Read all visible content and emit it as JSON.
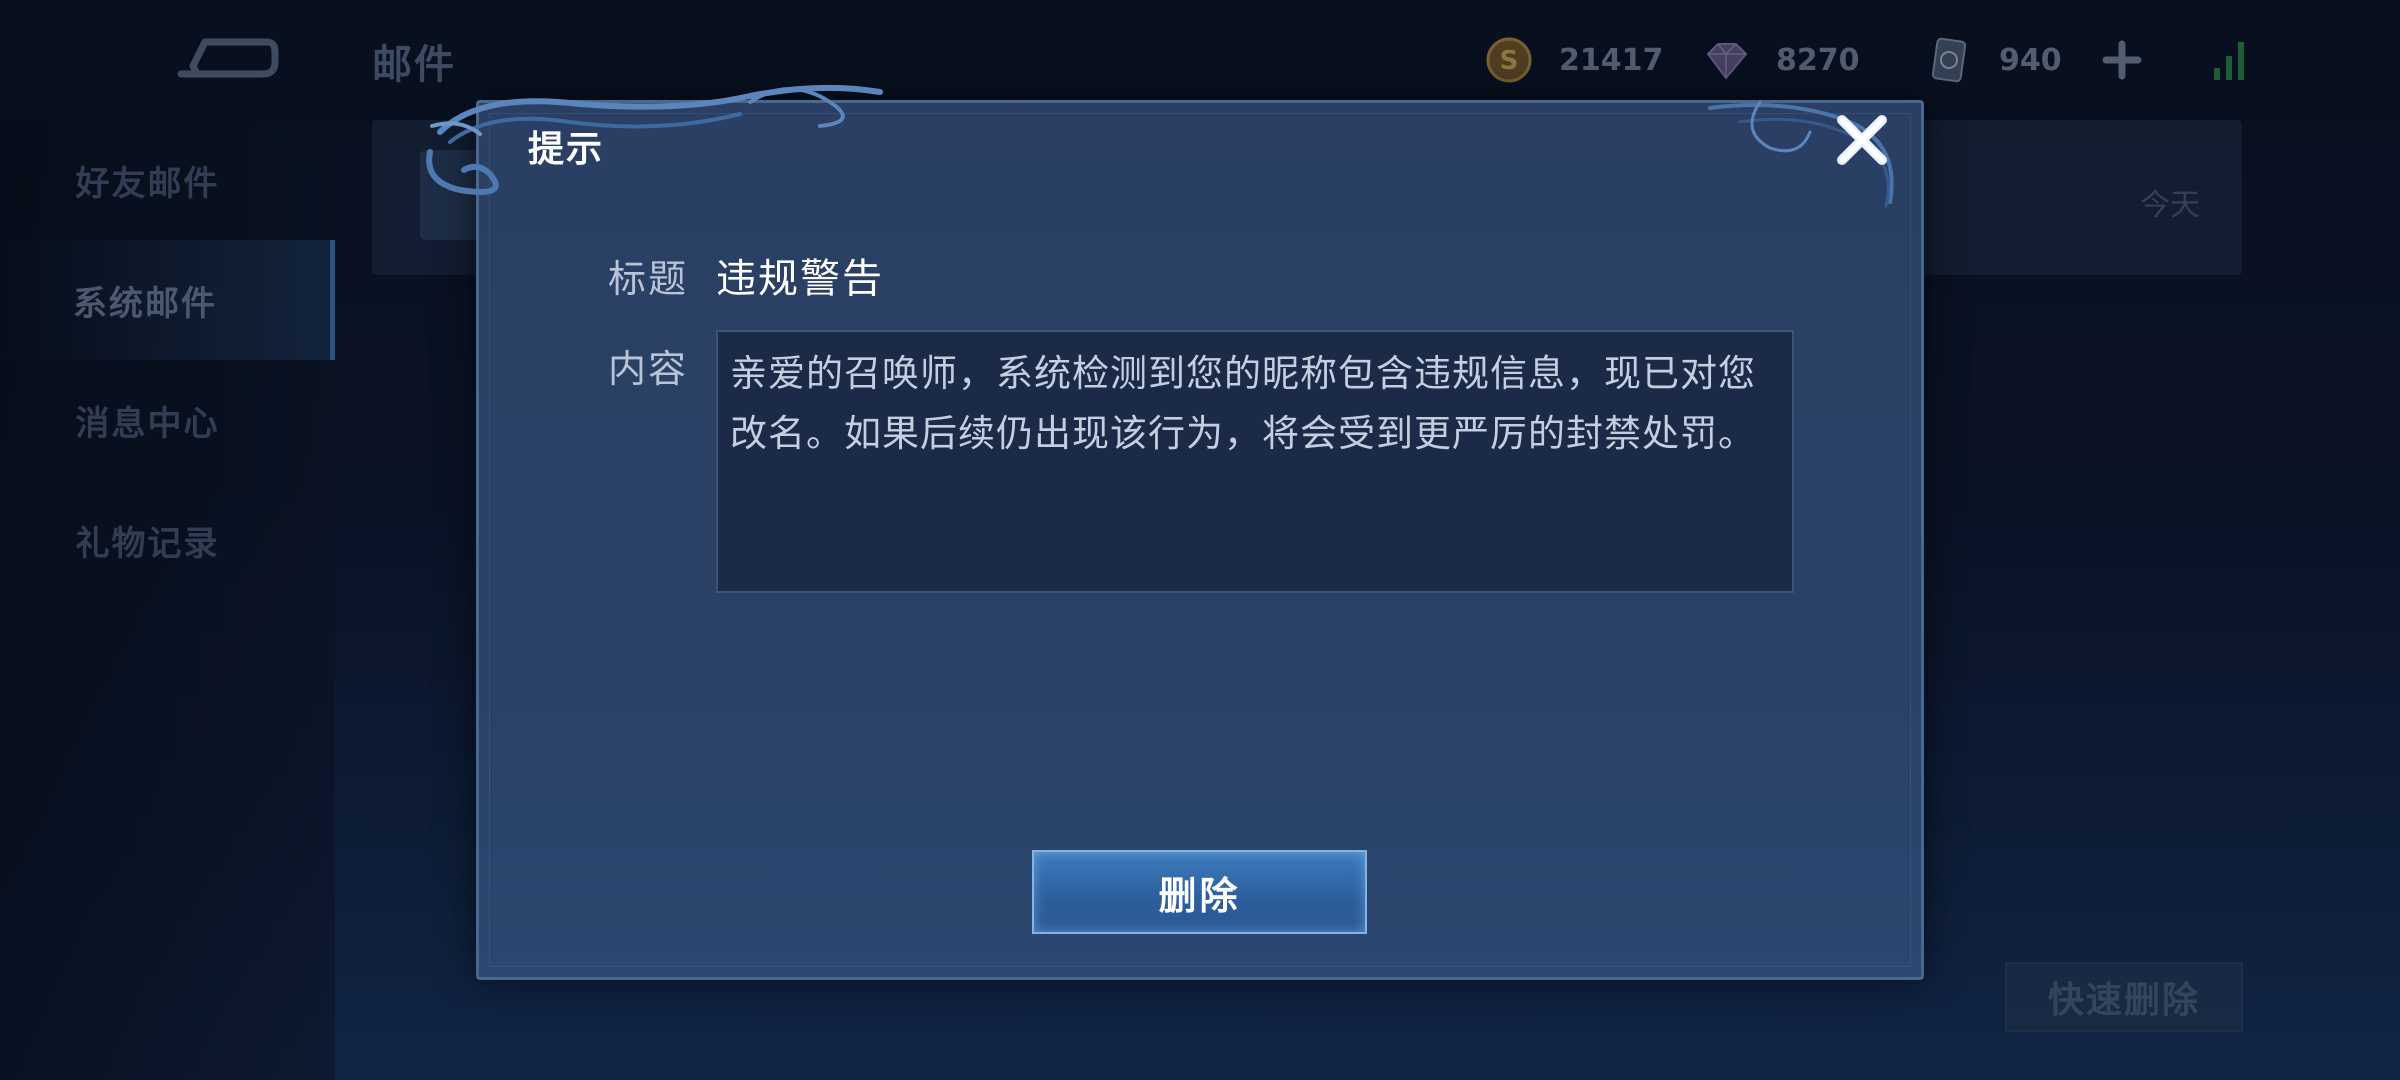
{
  "header": {
    "title": "邮件",
    "currencies": [
      {
        "icon": "gold-coin-icon",
        "value": "21417"
      },
      {
        "icon": "gem-icon",
        "value": "8270"
      },
      {
        "icon": "voucher-icon",
        "value": "940"
      }
    ]
  },
  "sidebar": {
    "items": [
      {
        "label": "好友邮件",
        "active": false
      },
      {
        "label": "系统邮件",
        "active": true
      },
      {
        "label": "消息中心",
        "active": false
      },
      {
        "label": "礼物记录",
        "active": false
      }
    ]
  },
  "mail_list": {
    "rows": [
      {
        "date": "今天"
      }
    ]
  },
  "footer": {
    "quick_delete_label": "快速删除"
  },
  "dialog": {
    "title": "提示",
    "subject_label": "标题",
    "subject_value": "违规警告",
    "content_label": "内容",
    "content_lines": [
      "亲爱的召唤师，系统检测到您的昵称包含违规信息，现已对您",
      "改名。如果后续仍出现该行为，将会受到更严厉的封禁处罚。"
    ],
    "delete_label": "删除"
  },
  "colors": {
    "dialog_bg": "#2a4067",
    "accent_button": "#3c7bbd",
    "background": "#0e1830"
  }
}
